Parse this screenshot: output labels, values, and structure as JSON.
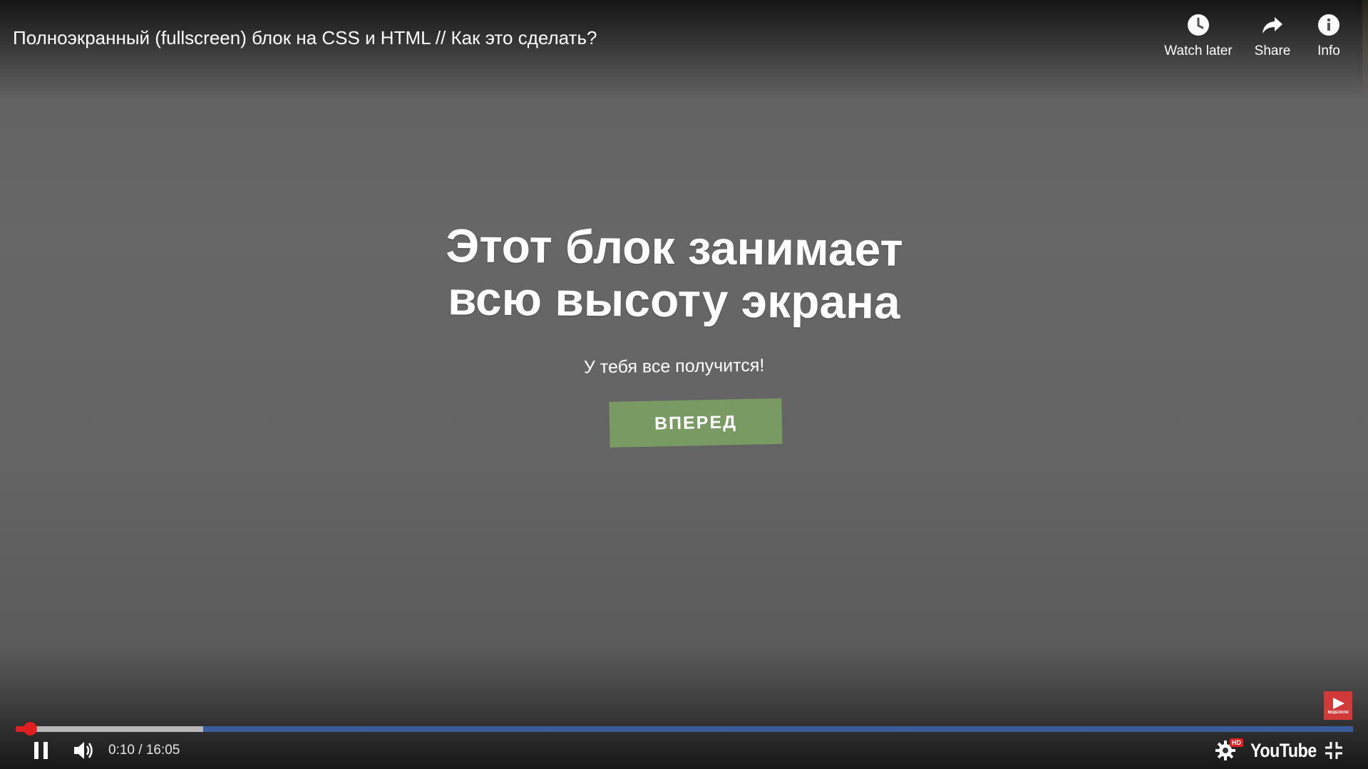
{
  "video": {
    "title": "Полноэкранный (fullscreen) блок на CSS и HTML // Как это сделать?"
  },
  "top_actions": [
    {
      "label": "Watch later",
      "icon": "clock-icon"
    },
    {
      "label": "Share",
      "icon": "share-arrow-icon"
    },
    {
      "label": "Info",
      "icon": "info-icon"
    }
  ],
  "content": {
    "title_line1": "Этот блок занимает",
    "title_line2": "всю высоту экрана",
    "subtitle": "У тебя все получится!",
    "button_label": "ВПЕРЕД",
    "button_color": "#7a9a63"
  },
  "channel_badge": {
    "icon": "play-logo-icon",
    "text": "ВИДЕОКОМ",
    "color": "#d23a3a"
  },
  "player": {
    "time_display": "0:10 / 16:05",
    "progress_played_fraction": 0.0107,
    "progress_buffered_fraction": 0.14,
    "progress_color": "#e02020",
    "brand": "YouTube",
    "hd_badge": "HD"
  }
}
